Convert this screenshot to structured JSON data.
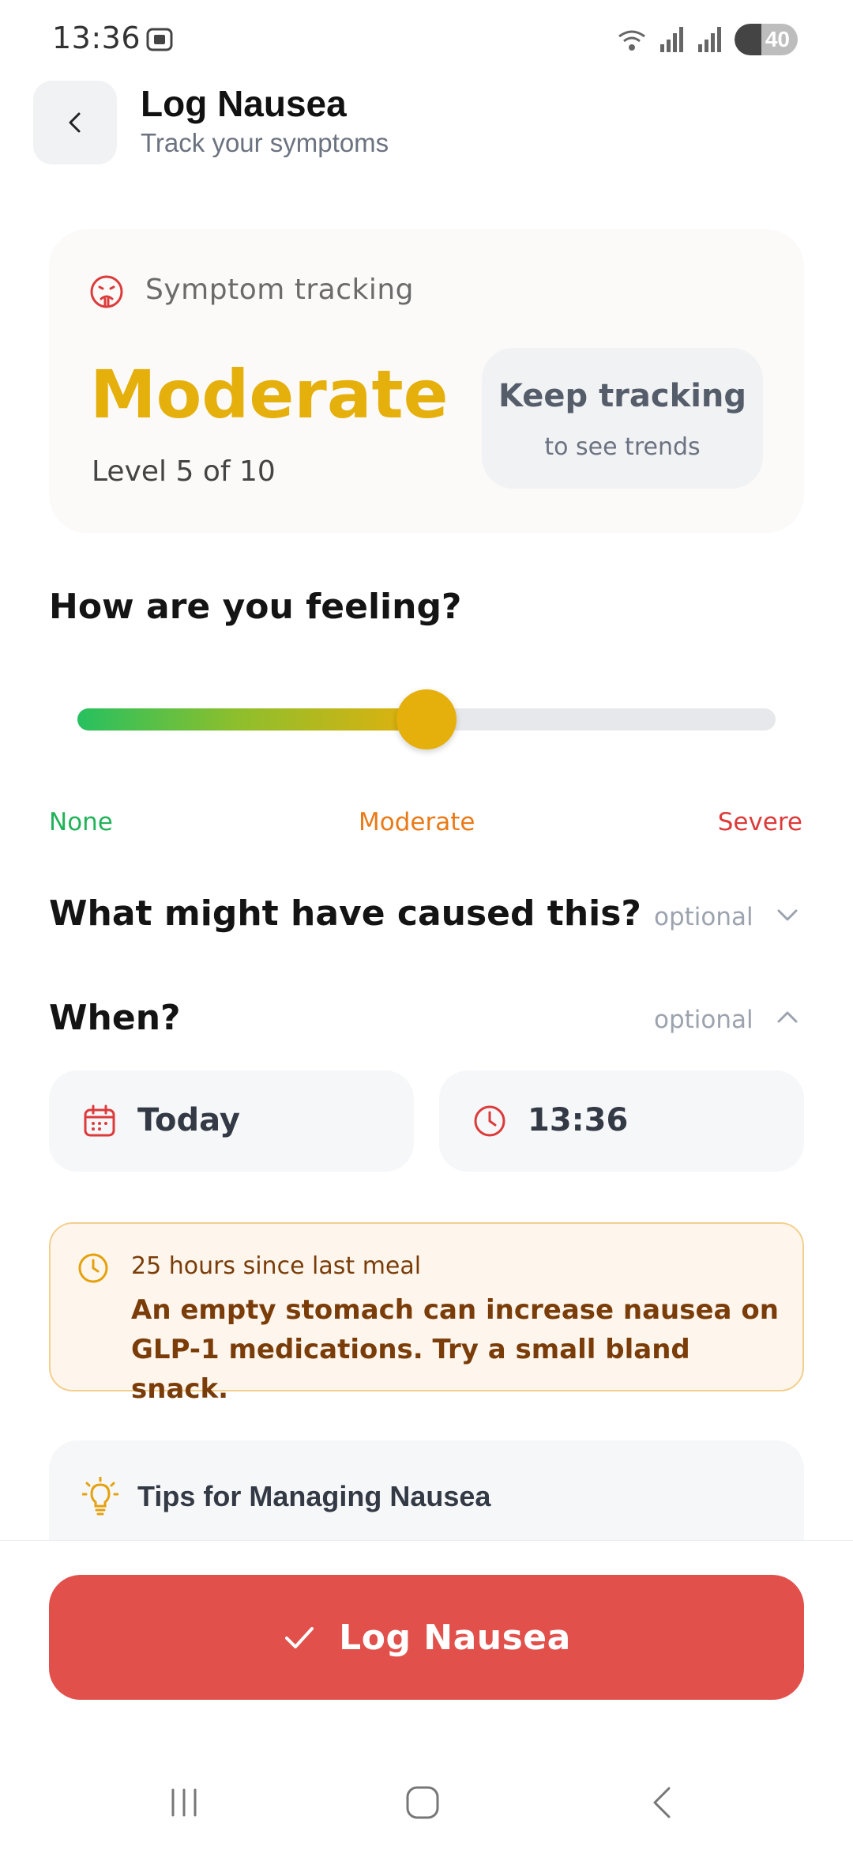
{
  "status_bar": {
    "time": "13:36",
    "battery": "40"
  },
  "header": {
    "title": "Log Nausea",
    "subtitle": "Track your symptoms"
  },
  "summary": {
    "label": "Symptom tracking",
    "level_word": "Moderate",
    "level_text": "Level 5 of 10",
    "trend_title": "Keep tracking",
    "trend_sub": "to see trends"
  },
  "feeling": {
    "title": "How are you feeling?",
    "level": 5,
    "max": 10,
    "scale_none": "None",
    "scale_moderate": "Moderate",
    "scale_severe": "Severe"
  },
  "cause": {
    "title": "What might have caused this?",
    "optional": "optional"
  },
  "when": {
    "title": "When?",
    "optional": "optional",
    "date": "Today",
    "time": "13:36"
  },
  "alert": {
    "heading": "25 hours since last meal",
    "body": "An empty stomach can increase nausea on GLP-1 medications. Try a small bland snack."
  },
  "tips": {
    "title": "Tips for Managing Nausea"
  },
  "cta": {
    "label": "Log Nausea"
  },
  "colors": {
    "accent_red": "#e2504c",
    "moderate_yellow": "#e5b00c",
    "none_green": "#22b35a",
    "severe_red": "#dc3b3b"
  },
  "icons": [
    "back-arrow-icon",
    "nausea-face-icon",
    "calendar-icon",
    "clock-icon",
    "lightbulb-icon",
    "check-icon",
    "chevron-down-icon",
    "chevron-up-icon"
  ]
}
